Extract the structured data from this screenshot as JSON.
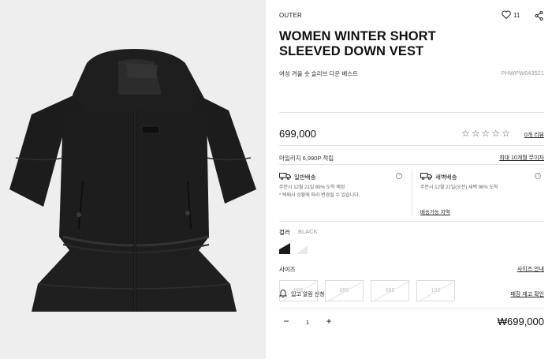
{
  "product": {
    "category": "OUTER",
    "wishlist_count": "11",
    "title_line1": "WOMEN WINTER SHORT",
    "title_line2": "SLEEVED DOWN VEST",
    "subtitle_ko": "여성 겨울 숏 슬리브 다운 베스트",
    "sku": "PHWPW643521",
    "price": "699,000",
    "rating_stars": 0,
    "reviews_link": "0개 리뷰",
    "mileage": "마일리지 6,990P 적립",
    "coupon_link": "최대 10개월 무이자"
  },
  "shipping": {
    "standard": {
      "title": "일반배송",
      "line1": "주문시 12월 21일 89% 도착 예정",
      "line2": "* 택배사 상황에 따라 변경될 수 있습니다."
    },
    "dawn": {
      "title": "새벽배송",
      "line1": "주문시 12월 21일(오전) 새벽 98% 도착",
      "area_link": "배송가능 지역"
    },
    "help_glyph": "?"
  },
  "options": {
    "color_label": "컬러",
    "color_value": "BLACK",
    "swatches": [
      {
        "name": "black",
        "hex": "#1a1a1a",
        "selected": true
      },
      {
        "name": "white",
        "hex": "#f2f2f2",
        "selected": false
      }
    ],
    "size_label": "사이즈",
    "size_guide_link": "사이즈 안내",
    "sizes": [
      "085",
      "090",
      "095",
      "100"
    ]
  },
  "restock": {
    "label": "입고 알림 신청",
    "store_link": "매장 재고 확인"
  },
  "order": {
    "minus": "−",
    "quantity": "1",
    "plus": "+",
    "total": "₩699,000"
  },
  "colors": {
    "gallery_bg": "#eeeeee",
    "jacket": "#1b1b1b",
    "divider": "#e4e4e4"
  }
}
